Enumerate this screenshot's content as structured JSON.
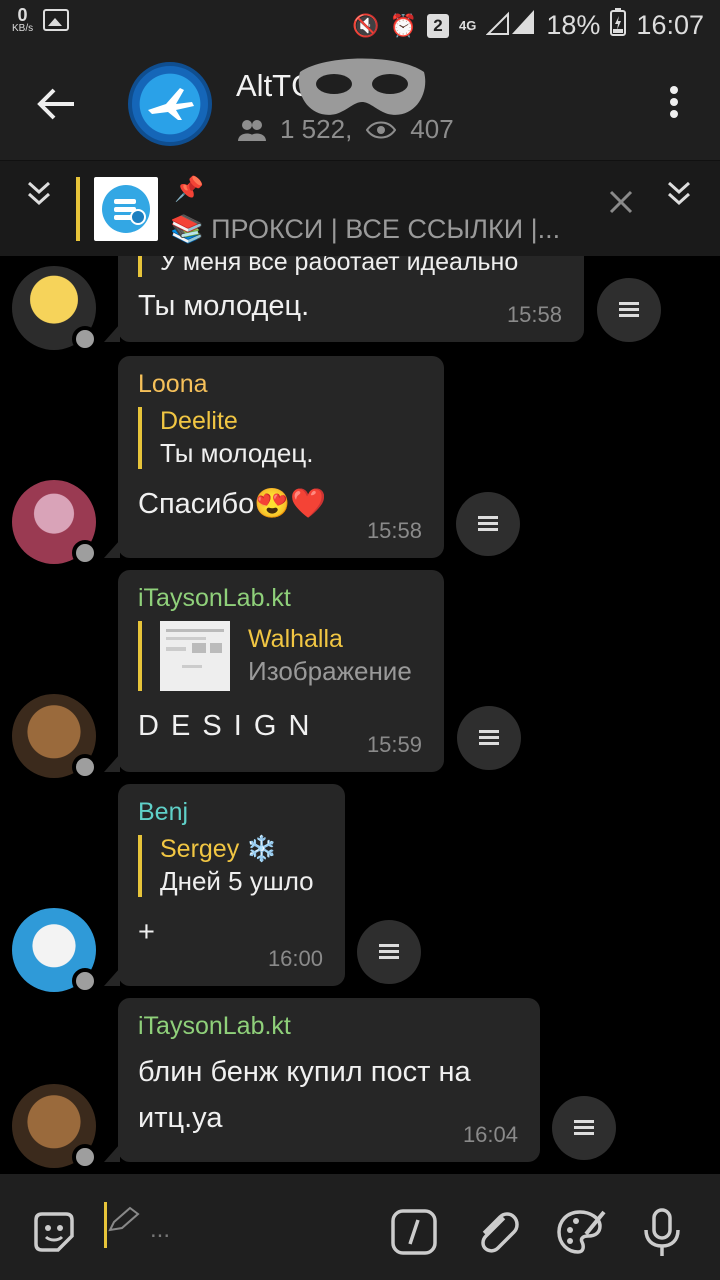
{
  "status_bar": {
    "speed_value": "0",
    "speed_unit": "KB/s",
    "sim_badge": "2",
    "network": "4G",
    "battery": "18%",
    "time": "16:07"
  },
  "header": {
    "title": "AltTG",
    "members": "1 522,",
    "online": "407"
  },
  "pinned": {
    "pushpin": "📌",
    "text": "📚 ПРОКСИ | ВСЕ ССЫЛКИ |..."
  },
  "messages": [
    {
      "quote_fragment": "У меня все работает идеально",
      "text": "Ты молодец.",
      "time": "15:58"
    },
    {
      "sender": "Loona",
      "quote_name": "Deelite",
      "quote_text": "Ты молодец.",
      "text": "Спасибо😍❤️",
      "time": "15:58"
    },
    {
      "sender": "iTaysonLab.kt",
      "quote_name": "Walhalla",
      "quote_text": "Изображение",
      "text": "D E S I G N",
      "time": "15:59"
    },
    {
      "sender": "Benj",
      "quote_name": "Sergey ❄️",
      "quote_text": "Дней 5 ушло",
      "text": "+",
      "time": "16:00"
    },
    {
      "sender": "iTaysonLab.kt",
      "text_line1": "блин бенж купил пост на",
      "text_line2": "итц.уа",
      "time": "16:04"
    }
  ],
  "input": {
    "placeholder": "..."
  },
  "colors": {
    "accent": "#e7c43a",
    "loona": "#f5c05a",
    "itayson": "#8fd07a",
    "benj": "#5fd0c8"
  }
}
